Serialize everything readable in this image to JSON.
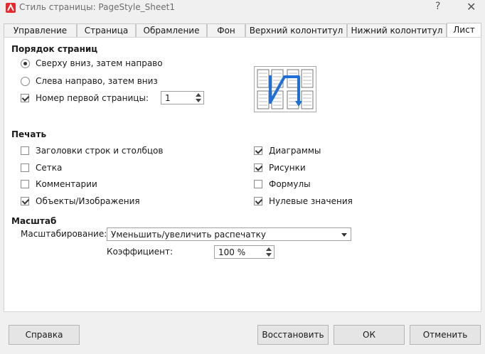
{
  "window": {
    "title": "Стиль страницы: PageStyle_Sheet1",
    "help_glyph": "?",
    "close_glyph": "✕",
    "app_icon": "libreoffice-calc-icon",
    "accent": "#e8282b"
  },
  "tabs": [
    {
      "label": "Управление"
    },
    {
      "label": "Страница"
    },
    {
      "label": "Обрамление"
    },
    {
      "label": "Фон"
    },
    {
      "label": "Верхний колонтитул"
    },
    {
      "label": "Нижний колонтитул"
    },
    {
      "label": "Лист",
      "active": true
    }
  ],
  "page_order": {
    "title": "Порядок страниц",
    "top_down": {
      "label": "Сверху вниз, затем направо",
      "selected": true
    },
    "left_right": {
      "label": "Слева направо, затем вниз",
      "selected": false
    },
    "first_page": {
      "label": "Номер первой страницы:",
      "checked": true,
      "value": "1"
    },
    "preview_arrow_color": "#1e6fd6"
  },
  "print": {
    "title": "Печать",
    "left": [
      {
        "label": "Заголовки строк и столбцов",
        "checked": false
      },
      {
        "label": "Сетка",
        "checked": false
      },
      {
        "label": "Комментарии",
        "checked": false
      },
      {
        "label": "Объекты/Изображения",
        "checked": true
      }
    ],
    "right": [
      {
        "label": "Диаграммы",
        "checked": true
      },
      {
        "label": "Рисунки",
        "checked": true
      },
      {
        "label": "Формулы",
        "checked": false
      },
      {
        "label": "Нулевые значения",
        "checked": true
      }
    ]
  },
  "scale": {
    "title": "Масштаб",
    "mode_label": "Масштабирование:",
    "mode_value": "Уменьшить/увеличить распечатку",
    "factor_label": "Коэффициент:",
    "factor_value": "100 %"
  },
  "buttons": {
    "help": "Справка",
    "reset": "Восстановить",
    "ok": "ОК",
    "cancel": "Отменить"
  }
}
